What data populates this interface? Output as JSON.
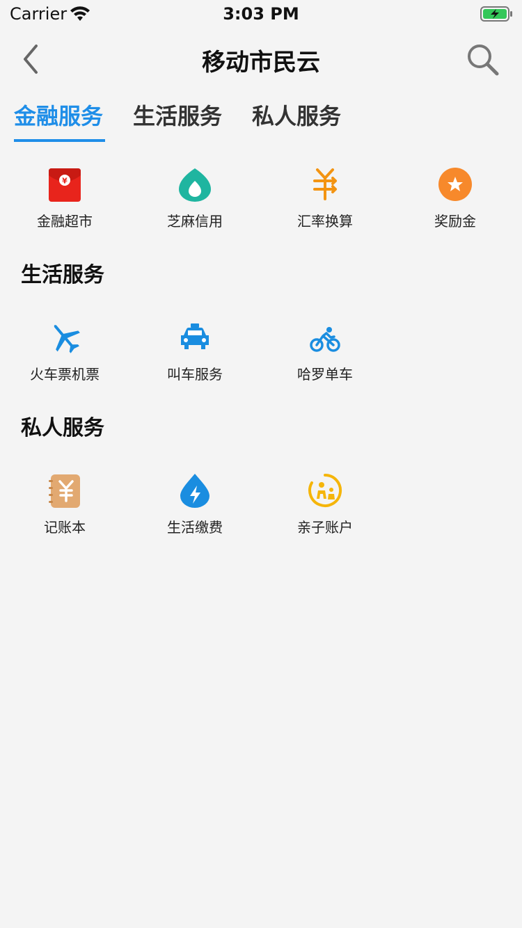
{
  "status": {
    "carrier": "Carrier",
    "time": "3:03 PM"
  },
  "nav": {
    "title": "移动市民云"
  },
  "tabs": [
    {
      "label": "金融服务"
    },
    {
      "label": "生活服务"
    },
    {
      "label": "私人服务"
    }
  ],
  "finance": {
    "items": [
      {
        "label": "金融超市",
        "icon": "red-envelope-icon"
      },
      {
        "label": "芝麻信用",
        "icon": "sesame-credit-icon"
      },
      {
        "label": "汇率换算",
        "icon": "currency-exchange-icon"
      },
      {
        "label": "奖励金",
        "icon": "reward-star-icon"
      }
    ]
  },
  "life": {
    "title": "生活服务",
    "items": [
      {
        "label": "火车票机票",
        "icon": "airplane-icon"
      },
      {
        "label": "叫车服务",
        "icon": "taxi-icon"
      },
      {
        "label": "哈罗单车",
        "icon": "bicycle-icon"
      }
    ]
  },
  "private": {
    "title": "私人服务",
    "items": [
      {
        "label": "记账本",
        "icon": "ledger-icon"
      },
      {
        "label": "生活缴费",
        "icon": "utility-bill-icon"
      },
      {
        "label": "亲子账户",
        "icon": "family-account-icon"
      }
    ]
  },
  "colors": {
    "accent": "#1f8ee8",
    "background": "#f4f4f4"
  }
}
